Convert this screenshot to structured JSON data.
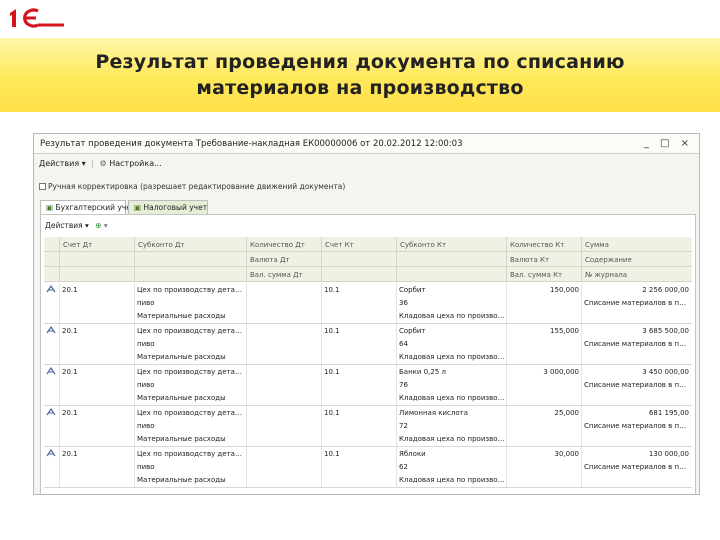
{
  "slide": {
    "title_line1": "Результат проведения документа по списанию",
    "title_line2": "материалов на производство"
  },
  "window": {
    "title": "Результат проведения документа Требование-накладная ЕК00000006 от 20.02.2012 12:00:03",
    "buttons": "_ □ ×",
    "actions_label": "Действия ▾",
    "settings_label": "Настройка...",
    "manual_checkbox_label": "Ручная корректировка (разрешает редактирование движений документа)"
  },
  "tabs": [
    {
      "label": "Бухгалтерский учет"
    },
    {
      "label": "Налоговый учет"
    }
  ],
  "table_toolbar": "Действия ▾",
  "columns": {
    "row1": [
      "Счет Дт",
      "Субконто Дт",
      "Количество Дт",
      "Счет Кт",
      "Субконто Кт",
      "Количество Кт",
      "Сумма"
    ],
    "row2_qty_dt": "Валюта Дт",
    "row2_qty_kt": "Валюта Кт",
    "row2_sum": "Содержание",
    "row3_qty_dt": "Вал. сумма Дт",
    "row3_qty_kt": "Вал. сумма Кт",
    "row3_sum": "№ журнала"
  },
  "rows": [
    {
      "dt_account": "20.1",
      "subconto_dt1": "Цех по производству деталей...",
      "subconto_dt2": "пиво",
      "subconto_dt3": "Материальные расходы",
      "kt_account": "10.1",
      "subconto_kt1": "Сорбит",
      "subconto_kt2": "36",
      "subconto_kt3": "Кладовая цеха по производс...",
      "qty_kt": "150,000",
      "sum": "2 256 000,00",
      "content": "Списание материалов в про..."
    },
    {
      "dt_account": "20.1",
      "subconto_dt1": "Цех по производству деталей...",
      "subconto_dt2": "пиво",
      "subconto_dt3": "Материальные расходы",
      "kt_account": "10.1",
      "subconto_kt1": "Сорбит",
      "subconto_kt2": "64",
      "subconto_kt3": "Кладовая цеха по производс...",
      "qty_kt": "155,000",
      "sum": "3 685 500,00",
      "content": "Списание материалов в про..."
    },
    {
      "dt_account": "20.1",
      "subconto_dt1": "Цех по производству деталей...",
      "subconto_dt2": "пиво",
      "subconto_dt3": "Материальные расходы",
      "kt_account": "10.1",
      "subconto_kt1": "Банки 0,25 л",
      "subconto_kt2": "76",
      "subconto_kt3": "Кладовая цеха по производс...",
      "qty_kt": "3 000,000",
      "sum": "3 450 000,00",
      "content": "Списание материалов в про..."
    },
    {
      "dt_account": "20.1",
      "subconto_dt1": "Цех по производству деталей...",
      "subconto_dt2": "пиво",
      "subconto_dt3": "Материальные расходы",
      "kt_account": "10.1",
      "subconto_kt1": "Лимонная кислота",
      "subconto_kt2": "72",
      "subconto_kt3": "Кладовая цеха по производс...",
      "qty_kt": "25,000",
      "sum": "681 195,00",
      "content": "Списание материалов в про..."
    },
    {
      "dt_account": "20.1",
      "subconto_dt1": "Цех по производству деталей...",
      "subconto_dt2": "пиво",
      "subconto_dt3": "Материальные расходы",
      "kt_account": "10.1",
      "subconto_kt1": "Яблоки",
      "subconto_kt2": "62",
      "subconto_kt3": "Кладовая цеха по производс...",
      "qty_kt": "30,000",
      "sum": "130 000,00",
      "content": "Списание материалов в про..."
    }
  ],
  "icons": {
    "logo": "1c-logo",
    "row_icon": "posting-icon"
  },
  "colors": {
    "banner": "#ffe85a",
    "logo_red": "#d4141c",
    "tab_inactive": "#e6efd6",
    "header_bg": "#f0f0e4"
  }
}
